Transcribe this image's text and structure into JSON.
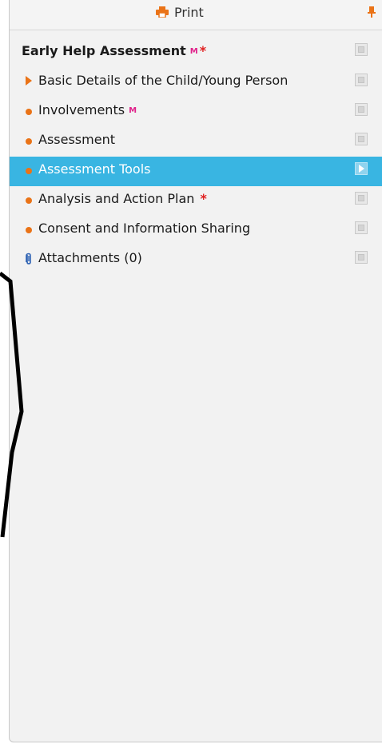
{
  "toolbar": {
    "print_label": "Print"
  },
  "panel": {
    "title": "Early Help Assessment",
    "title_marks": {
      "m": "M",
      "star": "*"
    },
    "items": [
      {
        "label": "Basic Details of the Child/Young Person",
        "icon": "arrow-icon"
      },
      {
        "label": "Involvements",
        "icon": "bullet-icon",
        "mark_m": "M"
      },
      {
        "label": "Assessment",
        "icon": "bullet-icon"
      },
      {
        "label": "Assessment Tools",
        "icon": "bullet-icon",
        "selected": true
      },
      {
        "label": "Analysis and Action Plan",
        "icon": "bullet-icon",
        "mark_star": "*"
      },
      {
        "label": "Consent and Information Sharing",
        "icon": "bullet-icon"
      },
      {
        "label": "Attachments (0)",
        "icon": "paperclip-icon"
      }
    ]
  },
  "colors": {
    "accent": "#ea7317",
    "selected_bg": "#39b5e2",
    "mandatory_m": "#e0218a",
    "required_star": "#e02020"
  }
}
